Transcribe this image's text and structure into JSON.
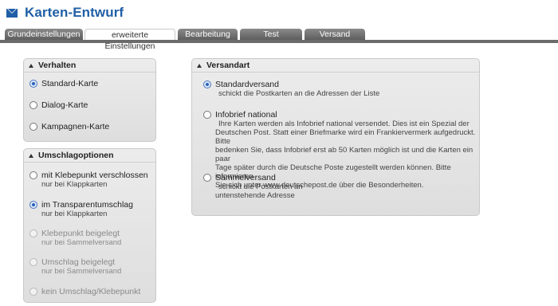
{
  "header": {
    "title": "Karten-Entwurf"
  },
  "tabs": [
    {
      "label": "Grundeinstellungen",
      "active": false
    },
    {
      "label": "erweiterte Einstellungen",
      "active": true
    },
    {
      "label": "Bearbeitung",
      "active": false
    },
    {
      "label": "Test",
      "active": false
    },
    {
      "label": "Versand",
      "active": false
    }
  ],
  "verhalten": {
    "title": "Verhalten",
    "options": [
      {
        "label": "Standard-Karte",
        "selected": true
      },
      {
        "label": "Dialog-Karte",
        "selected": false
      },
      {
        "label": "Kampagnen-Karte",
        "selected": false
      }
    ]
  },
  "umschlag": {
    "title": "Umschlagoptionen",
    "options": [
      {
        "label": "mit Klebepunkt verschlossen",
        "sub": "nur bei Klappkarten",
        "selected": false,
        "disabled": false
      },
      {
        "label": "im Transparentumschlag",
        "sub": "nur bei Klappkarten",
        "selected": true,
        "disabled": false
      },
      {
        "label": "Klebepunkt beigelegt",
        "sub": "nur bei Sammelversand",
        "selected": false,
        "disabled": true
      },
      {
        "label": "Umschlag beigelegt",
        "sub": "nur bei Sammelversand",
        "selected": false,
        "disabled": true
      },
      {
        "label": "kein Umschlag/Klebepunkt",
        "sub": "",
        "selected": false,
        "disabled": true
      }
    ]
  },
  "versandart": {
    "title": "Versandart",
    "options": [
      {
        "label": "Standardversand",
        "sub1": "schickt die Postkarten an die Adressen der Liste",
        "selected": true
      },
      {
        "label": "Infobrief national",
        "line1": "Ihre Karten werden als Infobrief national versendet. Dies ist ein Spezial der",
        "line2": "Deutschen Post. Statt einer Briefmarke wird ein Frankiervermerk aufgedruckt. Bitte",
        "line3": "bedenken Sie, dass Infobrief erst ab 50 Karten möglich ist und die Karten ein paar",
        "line4": "Tage später durch die Deutsche Poste zugestellt werden können. Bitte informieren",
        "line5": "Sie sich unter www.deutschepost.de über die Besonderheiten.",
        "selected": false
      },
      {
        "label": "Sammelversand",
        "line1": "schickt die Postkarten an",
        "line2": "untenstehende Adresse",
        "selected": false
      }
    ]
  },
  "colors": {
    "accent": "#1f5fa6",
    "tab_dark": "#6b6b6b",
    "panel_bg": "#e6e6e6"
  }
}
